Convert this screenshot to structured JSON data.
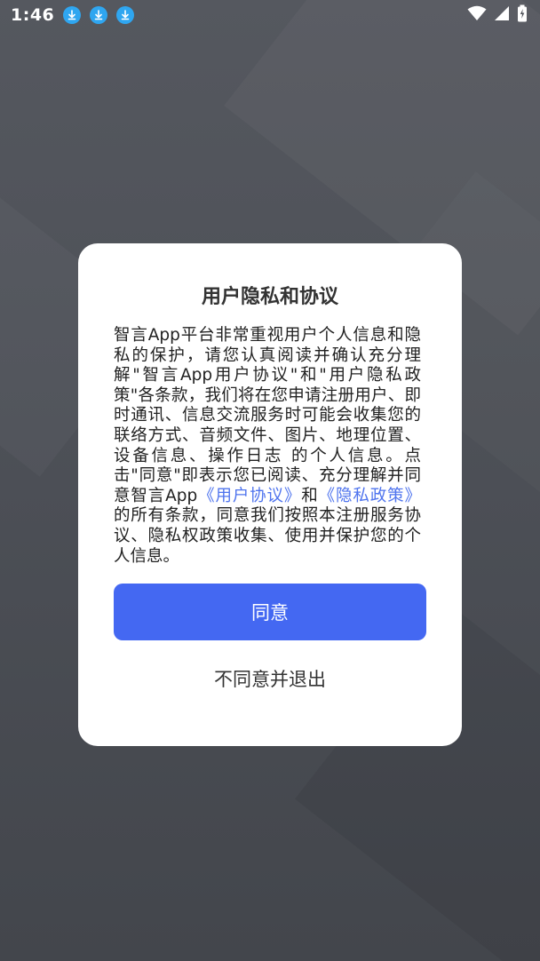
{
  "status_bar": {
    "time": "1:46",
    "notification_icons": [
      "download-icon",
      "download-icon",
      "download-icon"
    ],
    "right_icons": [
      "wifi-icon",
      "signal-icon",
      "battery-charging-icon"
    ]
  },
  "dialog": {
    "title": "用户隐私和协议",
    "body": {
      "intro": "智言App平台非常重视用户个人信息和隐私的保护，请您认真阅读并确认充分理解\"智言App用户协议\"和\"用户隐私政策\"各条款，我们将在您申请注册用户、即时通讯、信息交流服务时可能会收集您的联络方式、音频文件、图片、地理位置、设备信息、操作日志 的个人信息。点击\"同意\"即表示您已阅读、充分理解并同意智言App",
      "link_user_agreement": "《用户协议》",
      "conjunction": "和",
      "link_privacy_policy": "《隐私政策》",
      "outro": "的所有条款，同意我们按照本注册服务协议、隐私权政策收集、使用并保护您的个人信息。"
    },
    "agree_label": "同意",
    "disagree_label": "不同意并退出"
  },
  "colors": {
    "primary": "#4468f2",
    "link": "#4f74ee",
    "download_badge": "#2fa6f0"
  }
}
